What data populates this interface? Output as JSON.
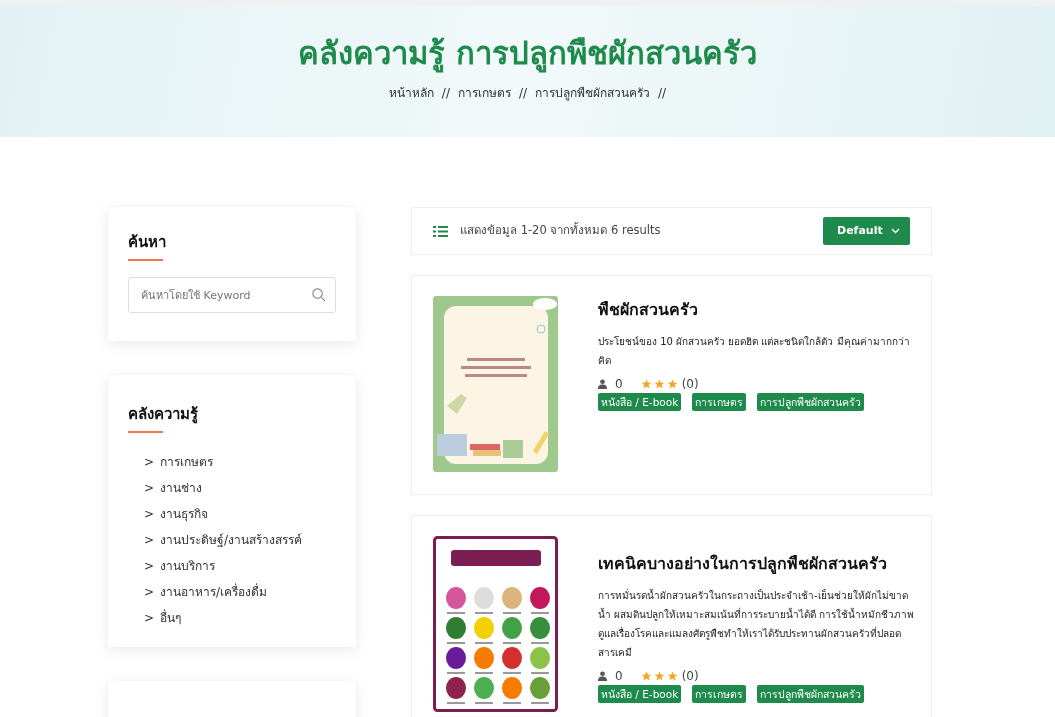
{
  "hero": {
    "title": "คลังความรู้ การปลูกพืชผักสวนครัว",
    "breadcrumb": [
      {
        "label": "หน้าหลัก",
        "separator": "//"
      },
      {
        "label": "การเกษตร",
        "separator": "//"
      },
      {
        "label": "การปลูกพืชผักสวนครัว",
        "separator": "//"
      }
    ]
  },
  "search_widget": {
    "title": "ค้นหา",
    "placeholder": "ค้นหาโดยใช้ Keyword"
  },
  "category_widget": {
    "title": "คลังความรู้",
    "items": [
      {
        "arrow": ">",
        "label": "การเกษตร"
      },
      {
        "arrow": ">",
        "label": "งานช่าง"
      },
      {
        "arrow": ">",
        "label": "งานธุรกิจ"
      },
      {
        "arrow": ">",
        "label": "งานประดิษฐ์/งานสร้างสรรค์"
      },
      {
        "arrow": ">",
        "label": "งานบริการ"
      },
      {
        "arrow": ">",
        "label": "งานอาหาร/เครื่องดื่ม"
      },
      {
        "arrow": ">",
        "label": "อื่นๆ"
      }
    ]
  },
  "results_bar": {
    "summary": "แสดงข้อมูล 1-20 จากทั้งหมด 6 results",
    "sort": "Default"
  },
  "books": [
    {
      "kind": "notebook",
      "title": "พืชผักสวนครัว",
      "description": "ประโยชน์ของ 10 ผักสวนครัว ยอดฮิต แต่ละชนิดใกล้ตัว มีคุณค่ามากกว่าคิด",
      "views": "0",
      "stars": 3,
      "reviews": "(0)",
      "tags": [
        "หนังสือ / E-book",
        "การเกษตร",
        "การปลูกพืชผักสวนครัว"
      ]
    },
    {
      "kind": "vegetables",
      "title": "เทคนิคบางอย่างในการปลูกพืชผักสวนครัว",
      "description": "การหมั่นรดน้ำผักสวนครัวในกระถางเป็นประจำเช้า-เย็นช่วยให้ผักไม่ขาดน้ำ ผสมดินปลูกให้เหมาะสมเน้นที่การระบายน้ำได้ดี การใช้น้ำหมักชีวภาพดูแลเรื่องโรคและแมลงศัตรูพืชทำให้เราได้รับประทานผักสวนครัวที่ปลอดสารเคมี",
      "views": "0",
      "stars": 3,
      "reviews": "(0)",
      "tags": [
        "หนังสือ / E-book",
        "การเกษตร",
        "การปลูกพืชผักสวนครัว"
      ]
    }
  ]
}
